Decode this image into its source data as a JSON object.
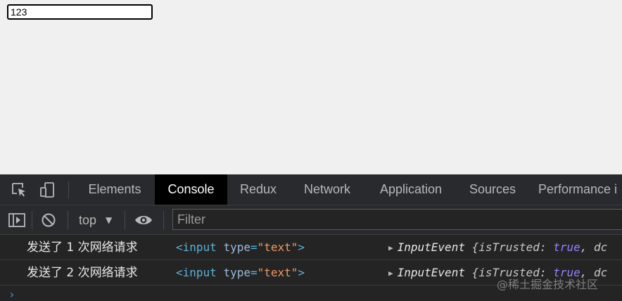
{
  "page": {
    "input_value": "123"
  },
  "devtools": {
    "tabs": [
      {
        "label": "Elements",
        "active": false
      },
      {
        "label": "Console",
        "active": true
      },
      {
        "label": "Redux",
        "active": false
      },
      {
        "label": "Network",
        "active": false
      },
      {
        "label": "Application",
        "active": false
      },
      {
        "label": "Sources",
        "active": false
      },
      {
        "label": "Performance i",
        "active": false
      }
    ],
    "toolbar": {
      "context": "top",
      "filter_placeholder": "Filter"
    },
    "console": {
      "rows": [
        {
          "message": "发送了 1 次网络请求",
          "element": {
            "tag_open": "<input",
            "attr_name": "type",
            "attr_eq": "=",
            "attr_value": "\"text\"",
            "tag_close": ">"
          },
          "object": {
            "type": "InputEvent",
            "brace": "{",
            "key": "isTrusted",
            "colon": ": ",
            "value": "true",
            "rest": ", dc"
          }
        },
        {
          "message": "发送了 2 次网络请求",
          "element": {
            "tag_open": "<input",
            "attr_name": "type",
            "attr_eq": "=",
            "attr_value": "\"text\"",
            "tag_close": ">"
          },
          "object": {
            "type": "InputEvent",
            "brace": "{",
            "key": "isTrusted",
            "colon": ": ",
            "value": "true",
            "rest": ", dc"
          }
        }
      ],
      "prompt": "›"
    }
  },
  "watermark": "@稀土掘金技术社区",
  "colors": {
    "devtools_bg": "#242424",
    "tag": "#5db0d7",
    "attr_value": "#f29766",
    "boolean": "#9980ff"
  },
  "icons": [
    "inspect-element-icon",
    "device-toolbar-icon",
    "sidebar-toggle-icon",
    "clear-console-icon",
    "dropdown-caret-icon",
    "eye-icon",
    "expand-triangle-icon",
    "prompt-chevron-icon"
  ]
}
